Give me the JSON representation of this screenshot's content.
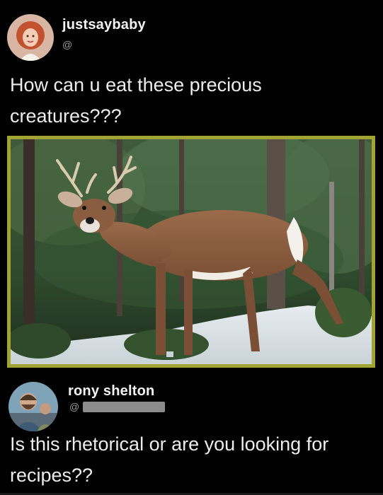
{
  "tweet1": {
    "username": "justsaybaby",
    "handle": "@",
    "text_line1": "How can u eat these precious",
    "text_line2": "creatures???"
  },
  "tweet2": {
    "username": "rony shelton",
    "handle": "@",
    "text_line1": "Is this rhetorical or are you looking for",
    "text_line2": "recipes??"
  },
  "colors": {
    "background": "#000000",
    "photo_border": "#a1a432",
    "handle_text": "#9a9a9a"
  }
}
